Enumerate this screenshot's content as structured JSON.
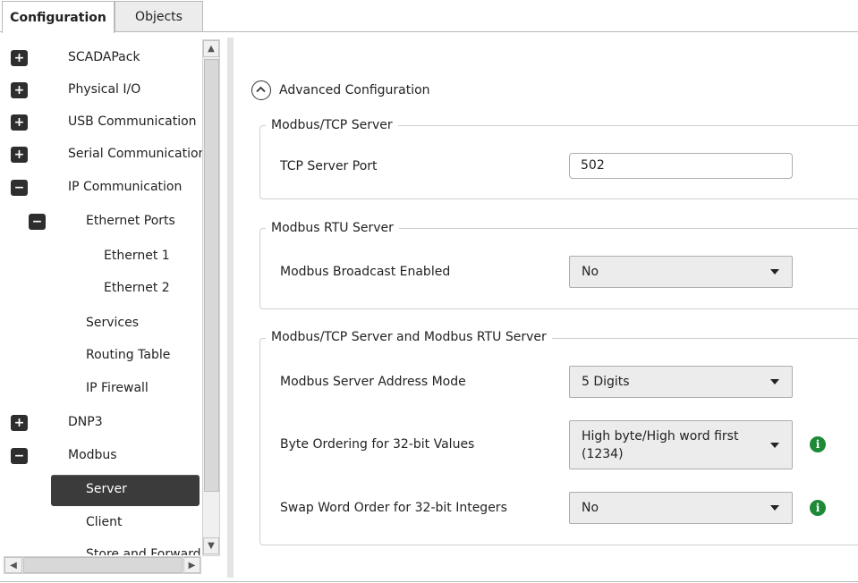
{
  "tabs": {
    "configuration": "Configuration",
    "objects": "Objects"
  },
  "tree": [
    {
      "label": "SCADAPack",
      "toggle": "+"
    },
    {
      "label": "Physical I/O",
      "toggle": "+"
    },
    {
      "label": "USB Communication",
      "toggle": "+"
    },
    {
      "label": "Serial Communication",
      "toggle": "+"
    },
    {
      "label": "IP Communication",
      "toggle": "−"
    },
    {
      "label": "Ethernet Ports",
      "toggle": "−"
    },
    {
      "label": "Ethernet 1"
    },
    {
      "label": "Ethernet 2"
    },
    {
      "label": "Services"
    },
    {
      "label": "Routing Table"
    },
    {
      "label": "IP Firewall"
    },
    {
      "label": "DNP3",
      "toggle": "+"
    },
    {
      "label": "Modbus",
      "toggle": "−"
    },
    {
      "label": "Server",
      "selected": true
    },
    {
      "label": "Client"
    },
    {
      "label": "Store and Forward"
    }
  ],
  "advanced": {
    "label": "Advanced Configuration"
  },
  "groups": {
    "tcp": {
      "title": "Modbus/TCP Server",
      "port_label": "TCP Server Port",
      "port_value": "502"
    },
    "rtu": {
      "title": "Modbus RTU Server",
      "broadcast_label": "Modbus Broadcast Enabled",
      "broadcast_value": "No"
    },
    "both": {
      "title": "Modbus/TCP Server and Modbus RTU Server",
      "address_mode_label": "Modbus Server Address Mode",
      "address_mode_value": "5 Digits",
      "byte_order_label": "Byte Ordering for 32-bit Values",
      "byte_order_value_line1": "High byte/High word first",
      "byte_order_value_line2": "(1234)",
      "swap_label": "Swap Word Order for 32-bit Integers",
      "swap_value": "No"
    }
  },
  "icons": {
    "info": "i",
    "scroll_up": "▲",
    "scroll_down": "▼",
    "scroll_left": "◀",
    "scroll_right": "▶"
  },
  "colors": {
    "selected_bg": "#3b3b3b",
    "info_green": "#1e8a38"
  }
}
